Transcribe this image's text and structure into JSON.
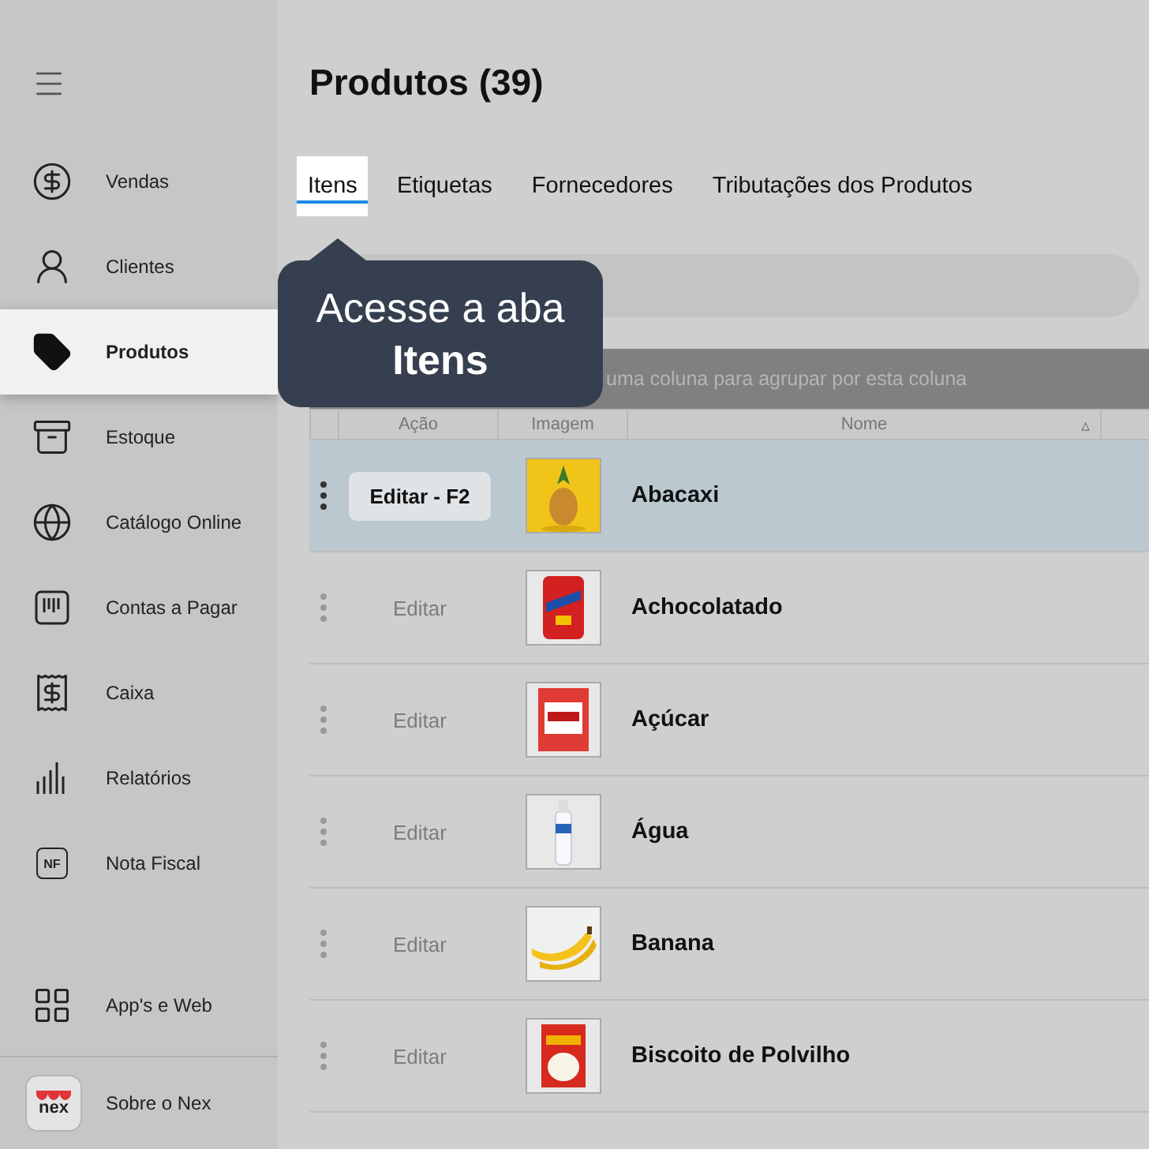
{
  "sidebar": {
    "items": [
      {
        "label": "Vendas",
        "selected": false
      },
      {
        "label": "Clientes",
        "selected": false
      },
      {
        "label": "Produtos",
        "selected": true
      },
      {
        "label": "Estoque",
        "selected": false
      },
      {
        "label": "Catálogo Online",
        "selected": false
      },
      {
        "label": "Contas a Pagar",
        "selected": false
      },
      {
        "label": "Caixa",
        "selected": false
      },
      {
        "label": "Relatórios",
        "selected": false
      },
      {
        "label": "Nota Fiscal",
        "selected": false,
        "icon_text": "NF"
      }
    ],
    "bottom_items": [
      {
        "label": "App's e Web"
      }
    ],
    "about": {
      "label": "Sobre o Nex",
      "logo_text": "nex"
    }
  },
  "page": {
    "title": "Produtos (39)"
  },
  "tabs": [
    {
      "label": "Itens",
      "selected": true
    },
    {
      "label": "Etiquetas",
      "selected": false
    },
    {
      "label": "Fornecedores",
      "selected": false
    },
    {
      "label": "Tributações dos Produtos",
      "selected": false
    }
  ],
  "tooltip": {
    "text": "Acesse a aba **Itens**"
  },
  "group_bar": {
    "text": "uma coluna para agrupar por esta coluna"
  },
  "table": {
    "columns": [
      {
        "label": "Ação"
      },
      {
        "label": "Imagem"
      },
      {
        "label": "Nome",
        "sort": "▵"
      }
    ],
    "rows": [
      {
        "action": "Editar - F2",
        "name": "Abacaxi",
        "selected": true
      },
      {
        "action": "Editar",
        "name": "Achocolatado",
        "selected": false
      },
      {
        "action": "Editar",
        "name": "Açúcar",
        "selected": false
      },
      {
        "action": "Editar",
        "name": "Água",
        "selected": false
      },
      {
        "action": "Editar",
        "name": "Banana",
        "selected": false
      },
      {
        "action": "Editar",
        "name": "Biscoito de Polvilho",
        "selected": false
      }
    ]
  }
}
